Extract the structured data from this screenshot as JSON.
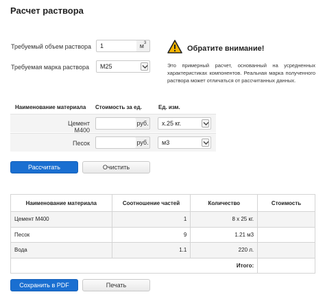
{
  "page": {
    "title": "Расчет раствора"
  },
  "volume": {
    "label": "Требуемый объем раствора",
    "value": "1",
    "unit_prefix": "м",
    "unit_sup": "3"
  },
  "grade": {
    "label": "Требуемая марка раствора",
    "value": "М25"
  },
  "warning": {
    "title": "Обратите внимание!",
    "text": "Это примерный расчет, основанный на усредненных характеристиках компонентов. Реальная марка полученного раствора может отличаться от рассчитанных данных."
  },
  "materials": {
    "headers": {
      "name": "Наименование материала",
      "cost": "Стоимость за ед.",
      "unit": "Ед. изм."
    },
    "rows": [
      {
        "name": "Цемент М400",
        "cost": "",
        "currency": "руб.",
        "unit": "x.25 кг."
      },
      {
        "name": "Песок",
        "cost": "",
        "currency": "руб.",
        "unit": "м3"
      }
    ]
  },
  "buttons": {
    "calculate": "Рассчитать",
    "clear": "Очистить",
    "save_pdf": "Сохранить в PDF",
    "print": "Печать"
  },
  "results": {
    "headers": [
      "Наименование материала",
      "Соотношение частей",
      "Количество",
      "Стоимость"
    ],
    "rows": [
      {
        "name": "Цемент М400",
        "ratio": "1",
        "quantity": "8 x 25 кг.",
        "cost": ""
      },
      {
        "name": "Песок",
        "ratio": "9",
        "quantity": "1.21 м3",
        "cost": ""
      },
      {
        "name": "Вода",
        "ratio": "1.1",
        "quantity": "220 л.",
        "cost": ""
      }
    ],
    "total_label": "Итого:",
    "total_value": ""
  },
  "colors": {
    "primary_button": "#1a6fd1",
    "warning_icon": "#f5b400"
  },
  "icons": {
    "warning": "warning-triangle-icon",
    "select_arrow": "chevron-down-icon"
  }
}
